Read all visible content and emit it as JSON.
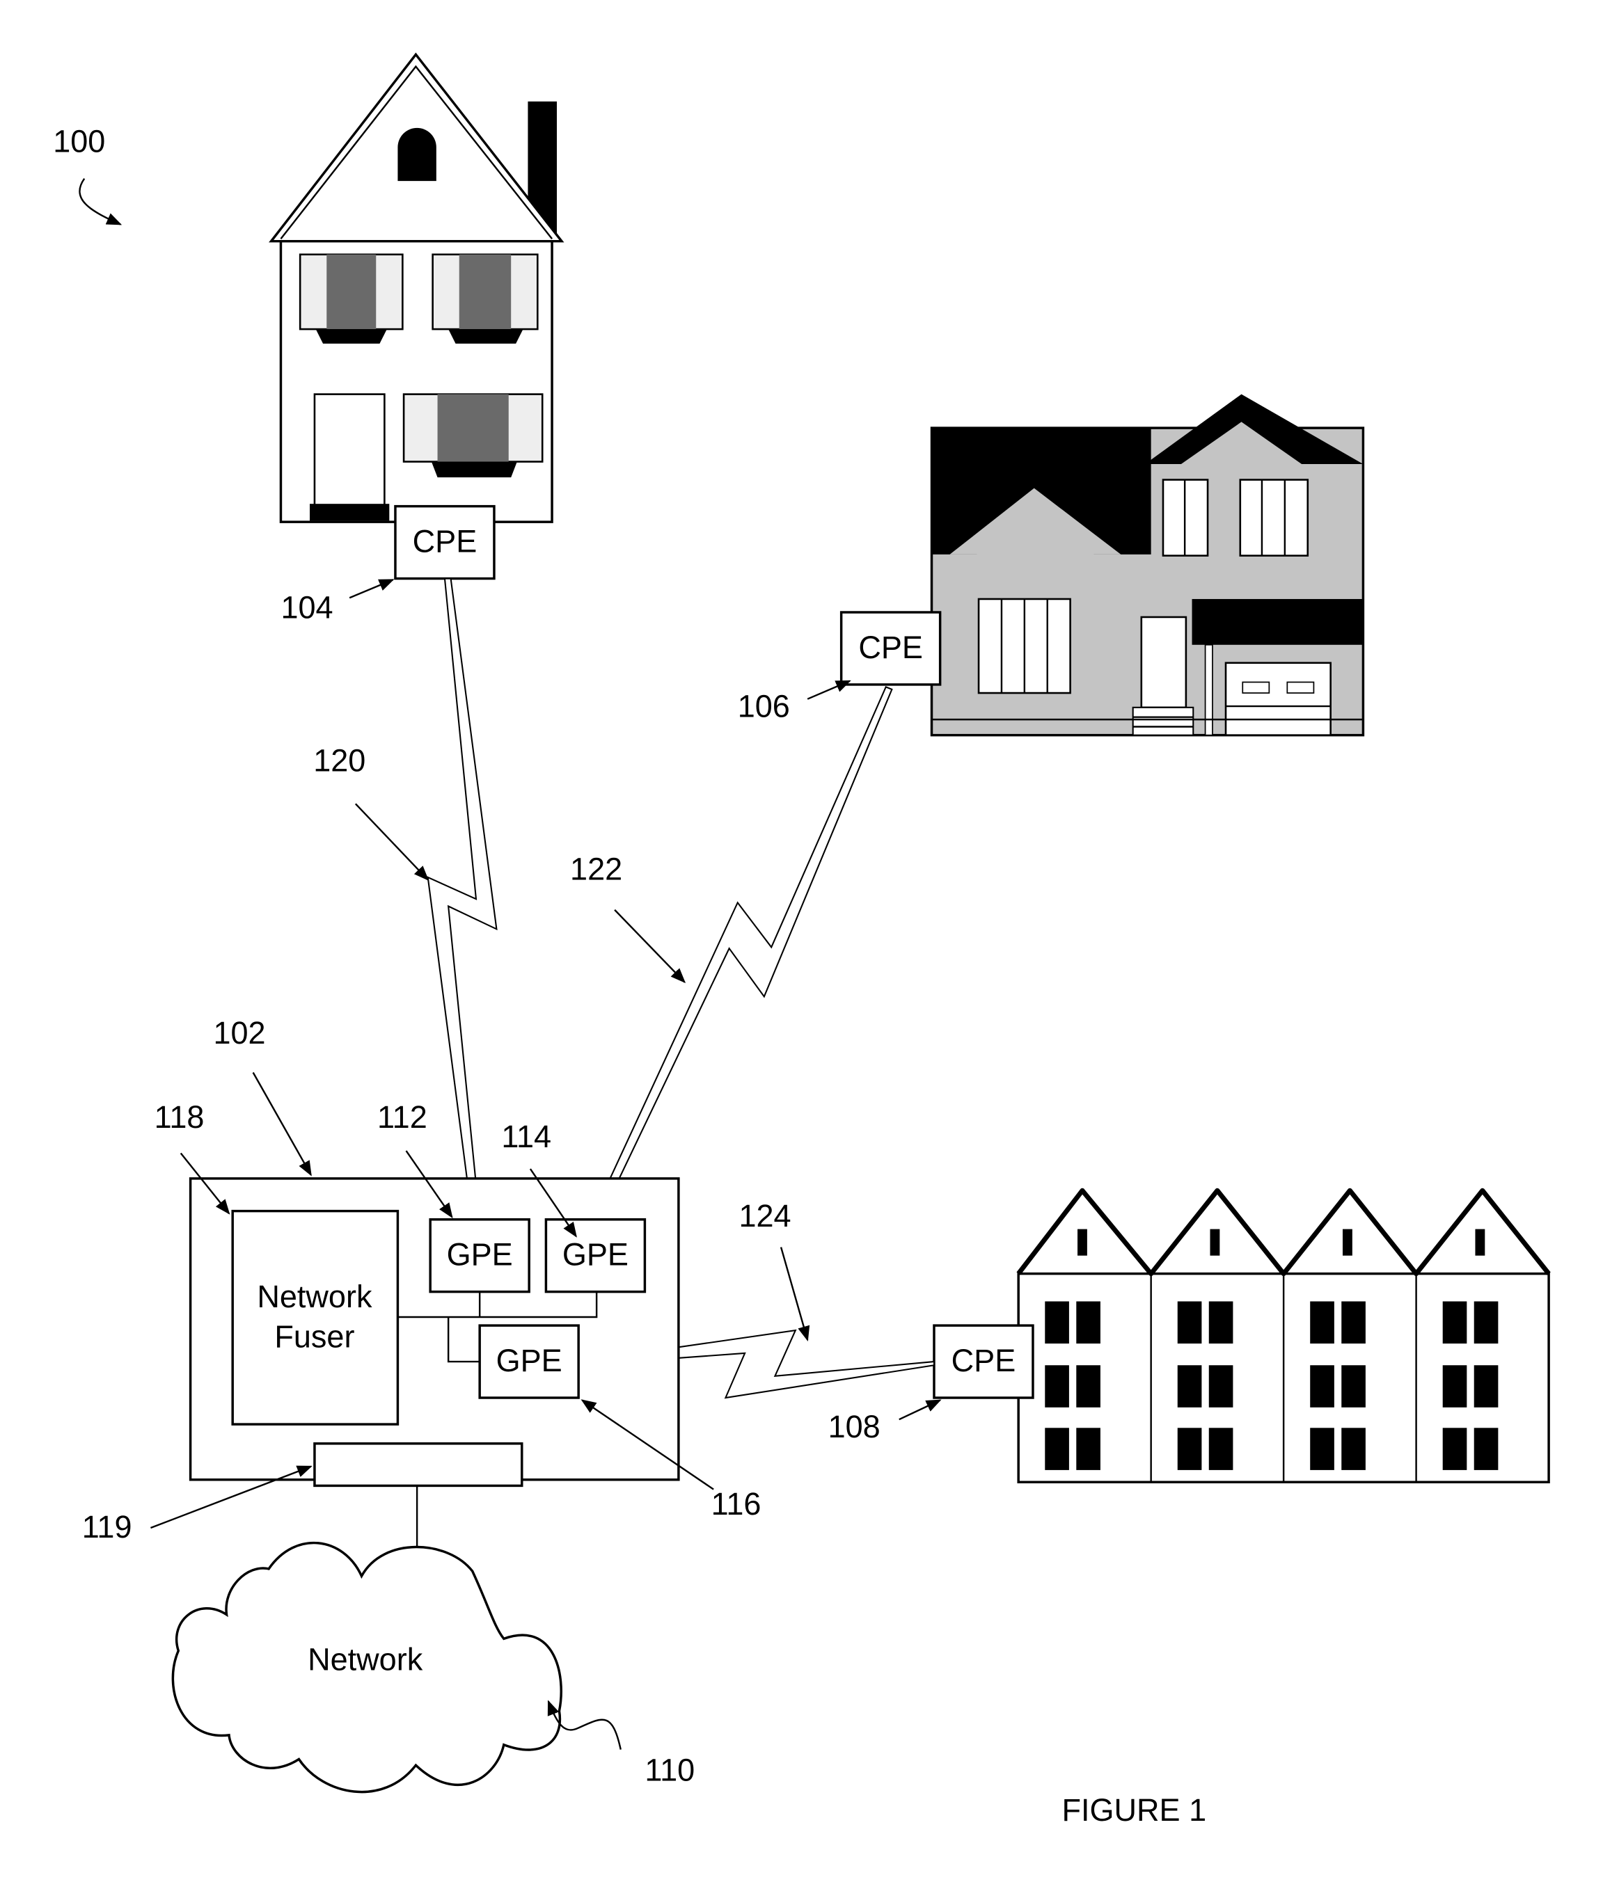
{
  "figure": {
    "caption": "FIGURE 1",
    "system_ref": "100"
  },
  "premises": [
    {
      "id": "house-top",
      "device_label": "CPE",
      "ref": "104"
    },
    {
      "id": "house-right",
      "device_label": "CPE",
      "ref": "106"
    },
    {
      "id": "row-houses",
      "device_label": "CPE",
      "ref": "108"
    }
  ],
  "hub": {
    "ref": "102",
    "network_fuser": {
      "line1": "Network",
      "line2": "Fuser",
      "ref": "118"
    },
    "gpe_units": [
      {
        "label": "GPE",
        "ref": "112"
      },
      {
        "label": "GPE",
        "ref": "114"
      },
      {
        "label": "GPE",
        "ref": "116"
      }
    ],
    "interface_ref": "119"
  },
  "network": {
    "label": "Network",
    "ref": "110"
  },
  "links": [
    {
      "ref": "120",
      "from": "CPE 104",
      "to": "GPE 112"
    },
    {
      "ref": "122",
      "from": "CPE 106",
      "to": "GPE 114"
    },
    {
      "ref": "124",
      "from": "CPE 108",
      "to": "GPE 116"
    }
  ]
}
